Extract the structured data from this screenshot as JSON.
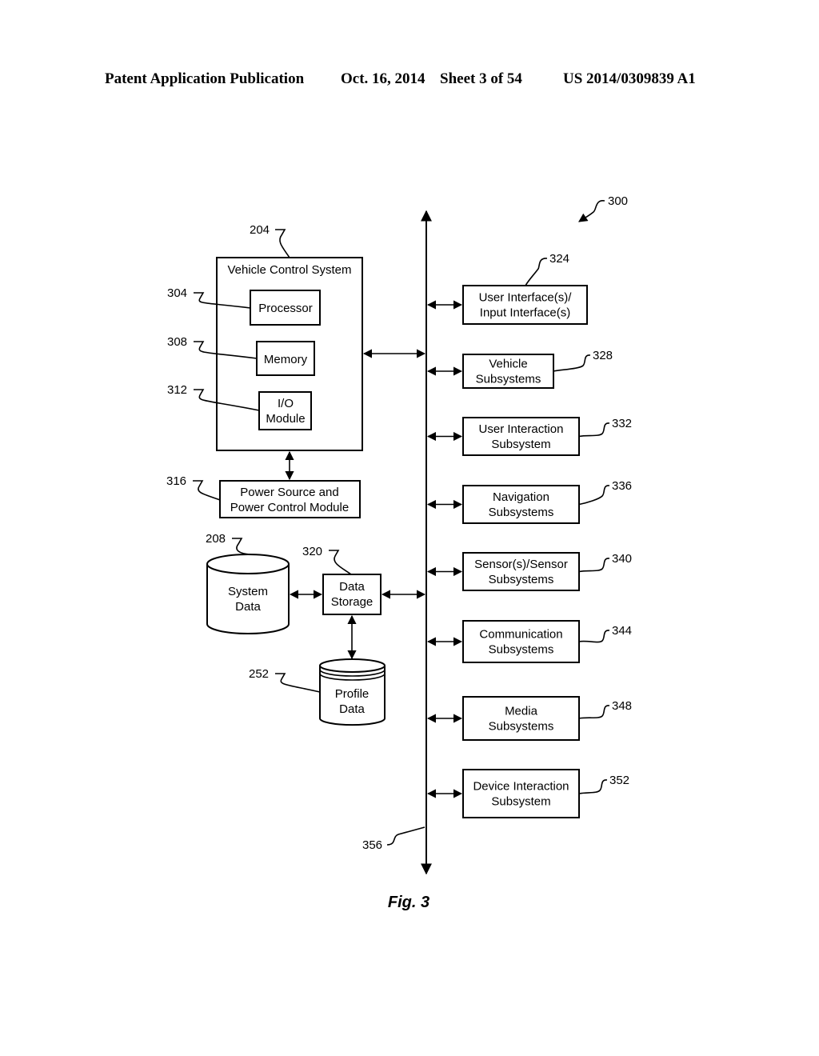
{
  "header": {
    "publication": "Patent Application Publication",
    "date": "Oct. 16, 2014",
    "sheet": "Sheet 3 of 54",
    "number": "US 2014/0309839 A1"
  },
  "figure": {
    "ref": "300",
    "caption": "Fig. 3",
    "bus_ref": "356"
  },
  "vcs": {
    "ref": "204",
    "title": "Vehicle Control System",
    "components": [
      {
        "ref": "304",
        "lines": [
          "Processor"
        ]
      },
      {
        "ref": "308",
        "lines": [
          "Memory"
        ]
      },
      {
        "ref": "312",
        "lines": [
          "I/O",
          "Module"
        ]
      }
    ]
  },
  "power": {
    "ref": "316",
    "lines": [
      "Power Source and",
      "Power Control Module"
    ]
  },
  "system_data": {
    "ref": "208",
    "lines": [
      "System",
      "Data"
    ]
  },
  "data_storage": {
    "ref": "320",
    "lines": [
      "Data",
      "Storage"
    ]
  },
  "profile_data": {
    "ref": "252",
    "lines": [
      "Profile",
      "Data"
    ]
  },
  "subsystems": [
    {
      "ref": "324",
      "lines": [
        "User Interface(s)/",
        "Input Interface(s)"
      ]
    },
    {
      "ref": "328",
      "lines": [
        "Vehicle",
        "Subsystems"
      ]
    },
    {
      "ref": "332",
      "lines": [
        "User Interaction",
        "Subsystem"
      ]
    },
    {
      "ref": "336",
      "lines": [
        "Navigation",
        "Subsystems"
      ]
    },
    {
      "ref": "340",
      "lines": [
        "Sensor(s)/Sensor",
        "Subsystems"
      ]
    },
    {
      "ref": "344",
      "lines": [
        "Communication",
        "Subsystems"
      ]
    },
    {
      "ref": "348",
      "lines": [
        "Media",
        "Subsystems"
      ]
    },
    {
      "ref": "352",
      "lines": [
        "Device Interaction",
        "Subsystem"
      ]
    }
  ]
}
